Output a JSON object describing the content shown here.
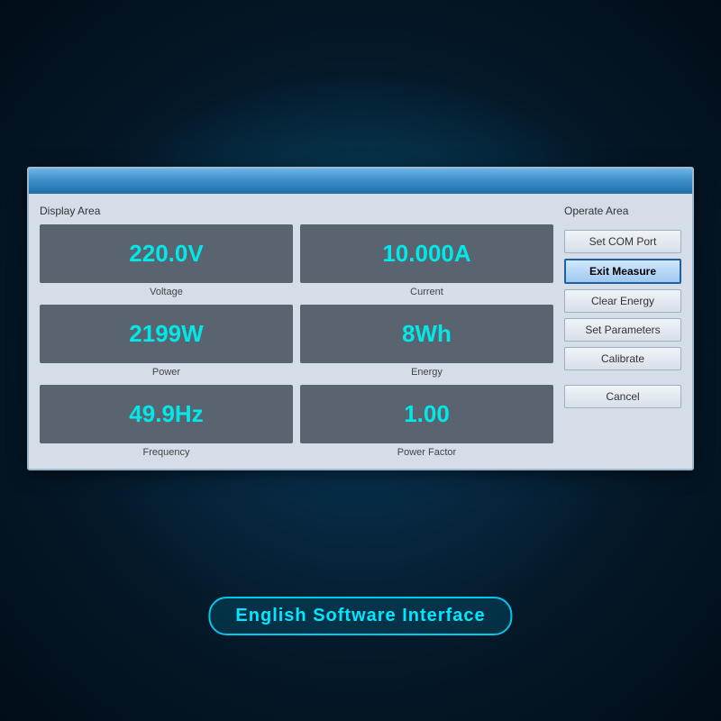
{
  "background": {
    "color": "#041828"
  },
  "dialog": {
    "display_area_label": "Display Area",
    "operate_area_label": "Operate Area",
    "metrics": [
      {
        "id": "voltage",
        "value": "220.0V",
        "label": "Voltage"
      },
      {
        "id": "current",
        "value": "10.000A",
        "label": "Current"
      },
      {
        "id": "power",
        "value": "2199W",
        "label": "Power"
      },
      {
        "id": "energy",
        "value": "8Wh",
        "label": "Energy"
      },
      {
        "id": "frequency",
        "value": "49.9Hz",
        "label": "Frequency"
      },
      {
        "id": "power-factor",
        "value": "1.00",
        "label": "Power Factor"
      }
    ],
    "buttons": [
      {
        "id": "set-com-port",
        "label": "Set COM Port",
        "active": false
      },
      {
        "id": "exit-measure",
        "label": "Exit Measure",
        "active": true
      },
      {
        "id": "clear-energy",
        "label": "Clear Energy",
        "active": false
      },
      {
        "id": "set-parameters",
        "label": "Set Parameters",
        "active": false
      },
      {
        "id": "calibrate",
        "label": "Calibrate",
        "active": false
      },
      {
        "id": "cancel",
        "label": "Cancel",
        "active": false,
        "spacer": true
      }
    ]
  },
  "bottom_label": "English Software Interface"
}
